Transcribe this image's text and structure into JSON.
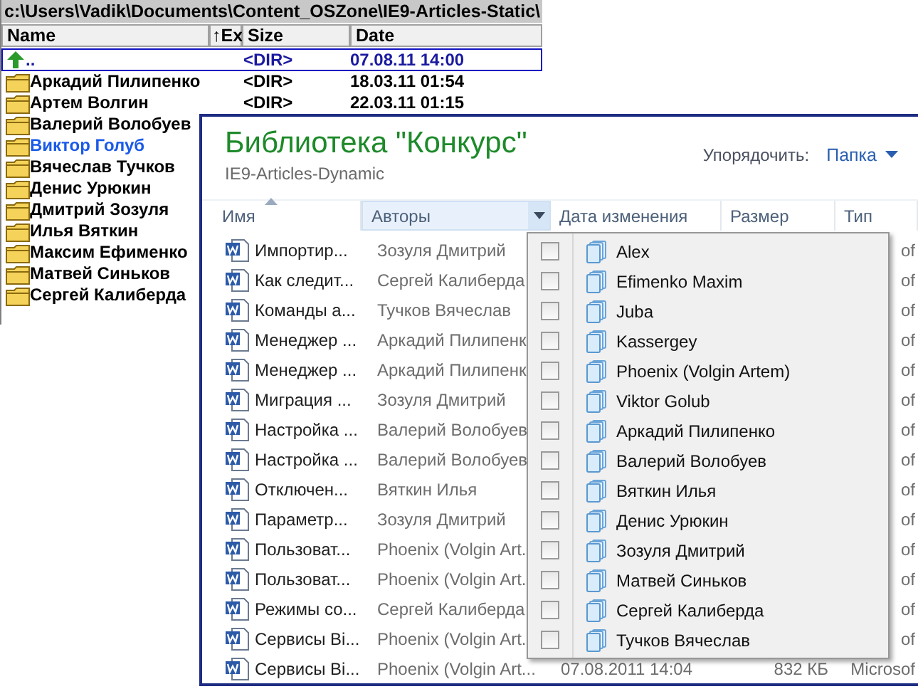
{
  "back_panel": {
    "path": "c:\\Users\\Vadik\\Documents\\Content_OSZone\\IE9-Articles-Static\\",
    "columns": [
      {
        "label": "Name"
      },
      {
        "label": "↑Ex"
      },
      {
        "label": "Size"
      },
      {
        "label": "Date"
      }
    ],
    "rows": [
      {
        "kind": "up",
        "name": "..",
        "size": "<DIR>",
        "date": "07.08.11 14:00",
        "cursor": true,
        "selected": false
      },
      {
        "kind": "folder",
        "name": "Аркадий Пилипенко",
        "size": "<DIR>",
        "date": "18.03.11 01:54",
        "cursor": false,
        "selected": false
      },
      {
        "kind": "folder",
        "name": "Артем Волгин",
        "size": "<DIR>",
        "date": "22.03.11 01:15",
        "cursor": false,
        "selected": false
      },
      {
        "kind": "folder",
        "name": "Валерий Волобуев",
        "cursor": false,
        "selected": false
      },
      {
        "kind": "folder",
        "name": "Виктор Голуб",
        "cursor": false,
        "selected": true
      },
      {
        "kind": "folder",
        "name": "Вячеслав Тучков",
        "cursor": false,
        "selected": false
      },
      {
        "kind": "folder",
        "name": "Денис Урюкин",
        "cursor": false,
        "selected": false
      },
      {
        "kind": "folder",
        "name": "Дмитрий Зозуля",
        "cursor": false,
        "selected": false
      },
      {
        "kind": "folder",
        "name": "Илья Вяткин",
        "cursor": false,
        "selected": false
      },
      {
        "kind": "folder",
        "name": "Максим Ефименко",
        "cursor": false,
        "selected": false
      },
      {
        "kind": "folder",
        "name": "Матвей Синьков",
        "cursor": false,
        "selected": false
      },
      {
        "kind": "folder",
        "name": "Сергей Калиберда",
        "cursor": false,
        "selected": false
      }
    ]
  },
  "library": {
    "title": "Библиотека \"Конкурс\"",
    "subtitle": "IE9-Articles-Dynamic",
    "arrange_label": "Упорядочить:",
    "arrange_value": "Папка",
    "columns": [
      {
        "label": "Имя",
        "sorted": true,
        "selected": false
      },
      {
        "label": "Авторы",
        "sorted": false,
        "selected": true
      },
      {
        "label": "Дата изменения",
        "sorted": false,
        "selected": false
      },
      {
        "label": "Размер",
        "sorted": false,
        "selected": false
      },
      {
        "label": "Тип",
        "sorted": false,
        "selected": false
      }
    ],
    "rows": [
      {
        "name": "Импортир...",
        "author": "Зозуля Дмитрий",
        "type": "of"
      },
      {
        "name": "Как следит...",
        "author": "Сергей Калиберда",
        "type": "of"
      },
      {
        "name": "Команды а...",
        "author": "Тучков Вячеслав",
        "type": "of"
      },
      {
        "name": "Менеджер ...",
        "author": "Аркадий Пилипенк",
        "type": "of"
      },
      {
        "name": "Менеджер ...",
        "author": "Аркадий Пилипенк",
        "type": "of"
      },
      {
        "name": "Миграция ...",
        "author": "Зозуля Дмитрий",
        "type": "of"
      },
      {
        "name": "Настройка ...",
        "author": "Валерий Волобуев",
        "type": "of"
      },
      {
        "name": "Настройка ...",
        "author": "Валерий Волобуев",
        "type": "of"
      },
      {
        "name": "Отключен...",
        "author": "Вяткин Илья",
        "type": "of"
      },
      {
        "name": "Параметр...",
        "author": "Зозуля Дмитрий",
        "type": "of"
      },
      {
        "name": "Пользоват...",
        "author": "Phoenix (Volgin Art.",
        "type": "of"
      },
      {
        "name": "Пользоват...",
        "author": "Phoenix (Volgin Art.",
        "type": "of"
      },
      {
        "name": "Режимы со...",
        "author": "Сергей Калиберда",
        "type": "of"
      },
      {
        "name": "Сервисы Bi...",
        "author": "Phoenix (Volgin Art.",
        "type": "of"
      },
      {
        "name": "Сервисы Bi...",
        "author": "Phoenix (Volgin Art...",
        "date": "07.08.2011 14:04",
        "size": "832 КБ",
        "type": "Microsof"
      }
    ],
    "filter_menu": {
      "items": [
        {
          "label": "Alex",
          "checked": false
        },
        {
          "label": "Efimenko Maxim",
          "checked": false
        },
        {
          "label": "Juba",
          "checked": false
        },
        {
          "label": "Kassergey",
          "checked": false
        },
        {
          "label": "Phoenix (Volgin Artem)",
          "checked": false
        },
        {
          "label": "Viktor Golub",
          "checked": false
        },
        {
          "label": "Аркадий Пилипенко",
          "checked": false
        },
        {
          "label": "Валерий Волобуев",
          "checked": false
        },
        {
          "label": "Вяткин Илья",
          "checked": false
        },
        {
          "label": "Денис Урюкин",
          "checked": false
        },
        {
          "label": "Зозуля Дмитрий",
          "checked": false
        },
        {
          "label": "Матвей Синьков",
          "checked": false
        },
        {
          "label": "Сергей Калиберда",
          "checked": false
        },
        {
          "label": "Тучков Вячеслав",
          "checked": false
        }
      ]
    }
  }
}
